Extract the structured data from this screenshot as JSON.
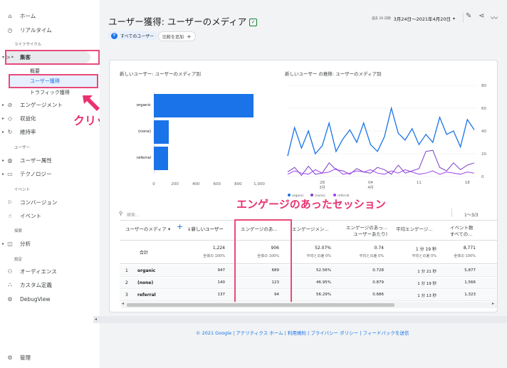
{
  "sidebar": {
    "home": "ホーム",
    "realtime": "リアルタイム",
    "lifecycle": "ライフサイクル",
    "acquisition": "集客",
    "overview": "概要",
    "user_acquisition": "ユーザー獲得",
    "traffic_acquisition": "トラフィック獲得",
    "engagement": "エンゲージメント",
    "monetization": "収益化",
    "retention": "維持率",
    "user_section": "ユーザー",
    "user_attributes": "ユーザー属性",
    "technology": "テクノロジー",
    "events_section": "イベント",
    "conversions": "コンバージョン",
    "events": "イベント",
    "explore_section": "探索",
    "analysis": "分析",
    "configure_section": "設定",
    "audiences": "オーディエンス",
    "custom_definitions": "カスタム定義",
    "debugview": "DebugView",
    "admin": "管理"
  },
  "header": {
    "title": "ユーザー獲得: ユーザーのメディア",
    "date_prefix": "過去 28 日間",
    "date_range": "3月24日～2021年4月20日",
    "filter_all_users": "すべてのユーザー",
    "add_comparison": "比較を追加"
  },
  "bar_chart": {
    "title": "新しいユーザー: ユーザーのメディア別",
    "x_ticks": [
      "0",
      "200",
      "400",
      "600",
      "800",
      "1,000"
    ]
  },
  "line_chart": {
    "title": "新しいユーザー の推移: ユーザーのメディア別",
    "y_ticks": [
      "80",
      "60",
      "40",
      "20",
      "0"
    ],
    "x_ticks": [
      "28",
      "04",
      "11",
      "18"
    ],
    "x_month_ticks": [
      "3月",
      "4月"
    ],
    "legend": [
      "organic",
      "(none)",
      "referral"
    ]
  },
  "chart_data": [
    {
      "type": "bar",
      "title": "新しいユーザー: ユーザーのメディア別",
      "categories": [
        "organic",
        "(none)",
        "referral"
      ],
      "values": [
        947,
        140,
        137
      ],
      "xlim": [
        0,
        1000
      ],
      "orientation": "horizontal",
      "color": "#1a73e8"
    },
    {
      "type": "line",
      "title": "新しいユーザー の推移: ユーザーのメディア別",
      "ylim": [
        0,
        80
      ],
      "x": [
        1,
        2,
        3,
        4,
        5,
        6,
        7,
        8,
        9,
        10,
        11,
        12,
        13,
        14,
        15,
        16,
        17,
        18,
        19,
        20,
        21,
        22,
        23,
        24,
        25,
        26,
        27,
        28
      ],
      "series": [
        {
          "name": "organic",
          "color": "#1a73e8",
          "values": [
            18,
            43,
            25,
            40,
            20,
            27,
            47,
            22,
            33,
            41,
            30,
            47,
            28,
            22,
            35,
            60,
            38,
            32,
            42,
            28,
            37,
            30,
            52,
            37,
            40,
            26,
            50,
            41
          ]
        },
        {
          "name": "(none)",
          "color": "#7b3fc4",
          "values": [
            4,
            8,
            1,
            9,
            2,
            3,
            12,
            6,
            5,
            2,
            7,
            4,
            3,
            8,
            6,
            2,
            10,
            3,
            5,
            7,
            22,
            23,
            8,
            5,
            12,
            6,
            10,
            12
          ]
        },
        {
          "name": "referral",
          "color": "#a142f4",
          "values": [
            2,
            5,
            3,
            2,
            6,
            3,
            4,
            7,
            2,
            3,
            5,
            4,
            6,
            3,
            2,
            5,
            3,
            6,
            4,
            2,
            3,
            5,
            2,
            4,
            3,
            2,
            4,
            3
          ]
        }
      ]
    }
  ],
  "table": {
    "search_placeholder": "検索...",
    "pagination": "1～3/3",
    "dim_header": "ユーザーのメディア",
    "new_users_header": "↓新しいユーザー",
    "columns": [
      "エンゲージのあ...",
      "エンゲージメン...",
      "エンゲージのあっ... ユーザーあたり)",
      "平均エンゲージ...",
      "イベント数 すべての..."
    ],
    "total_label": "合計",
    "totals": [
      "1,224",
      "906",
      "52.07%",
      "0.74",
      "1 分 19 秒",
      "8,771"
    ],
    "totals_sub": [
      "全体の 100%",
      "全体の 100%",
      "平均との差 0%",
      "平均との差 0%",
      "平均との差 0%",
      "全体の 100%"
    ],
    "rows": [
      {
        "idx": "1",
        "name": "organic",
        "vals": [
          "947",
          "689",
          "52.56%",
          "0.728",
          "1 分 21 秒",
          "5,877"
        ]
      },
      {
        "idx": "2",
        "name": "(none)",
        "vals": [
          "140",
          "123",
          "46.95%",
          "0.879",
          "1 分 19 秒",
          "1,566"
        ]
      },
      {
        "idx": "3",
        "name": "referral",
        "vals": [
          "137",
          "94",
          "56.29%",
          "0.686",
          "1 分 13 秒",
          "1,323"
        ]
      }
    ]
  },
  "annotations": {
    "click": "クリック",
    "engaged_sessions": "エンゲージのあったセッション"
  },
  "footer": {
    "text": "© 2021 Google | アナリティクス ホーム | 利用規約 | プライバシー ポリシー | フィードバックを送信"
  },
  "colors": {
    "accent": "#1a73e8",
    "annotation": "#e8336f",
    "purple": "#7b3fc4"
  }
}
